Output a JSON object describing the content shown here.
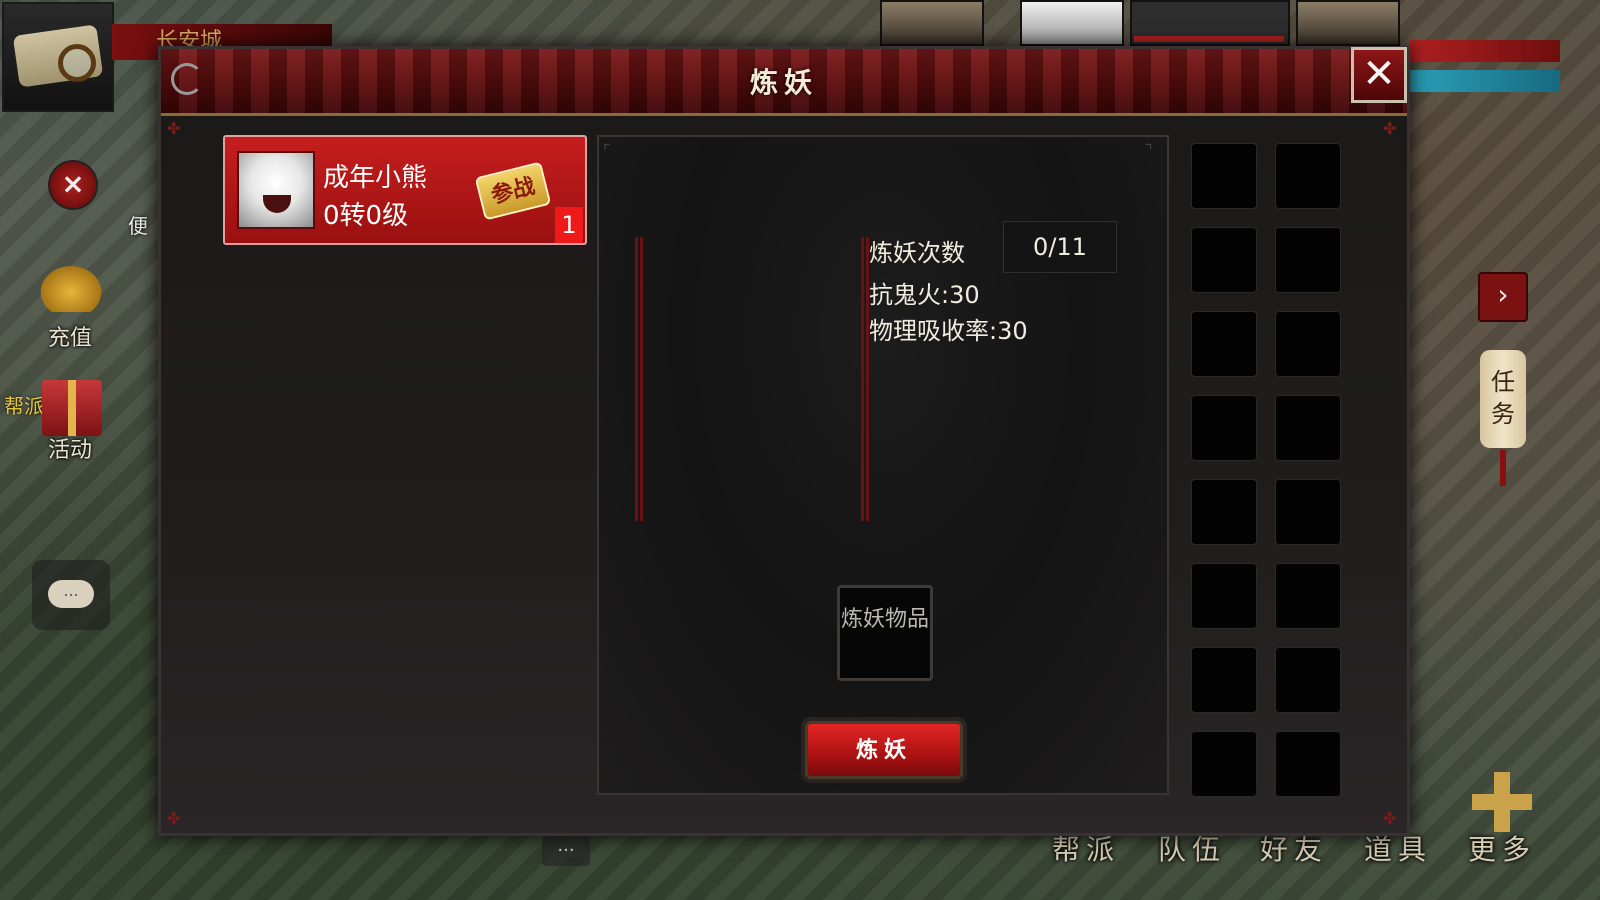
{
  "scene": {
    "city_name": "长安城",
    "side_partial_label": "便",
    "recharge_label": "充值",
    "activity_label": "活动",
    "guild_tag": "帮派",
    "chat_dots": "...",
    "task_label": "任务",
    "bottom_menu": [
      "帮派",
      "队伍",
      "好友",
      "道具",
      "更多"
    ]
  },
  "modal": {
    "title": "炼妖",
    "close_label": "✕"
  },
  "pet_list": [
    {
      "name": "成年小熊",
      "level": "0转0级",
      "badge": "参战",
      "count": "1"
    }
  ],
  "refine": {
    "count_label": "炼妖次数",
    "count_value": "0/11",
    "stats": [
      "抗鬼火:30",
      "物理吸收率:30"
    ],
    "item_slot_label": "炼妖物品",
    "button_label": "炼妖"
  },
  "inventory": {
    "columns": 2,
    "rows": 8
  },
  "colors": {
    "accent_red": "#c61e1e",
    "title_red": "#7d1a1a",
    "panel_bg": "#1b1818"
  }
}
